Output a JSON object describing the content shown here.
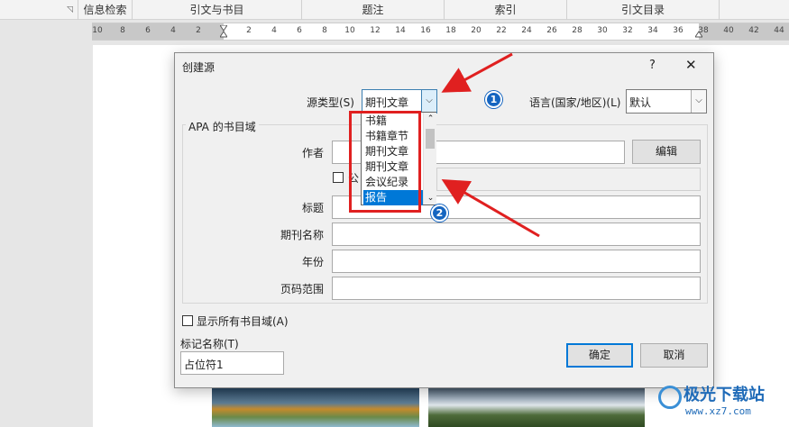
{
  "ribbon": {
    "groups": [
      "信息检索",
      "引文与书目",
      "题注",
      "索引",
      "引文目录"
    ]
  },
  "ruler": {
    "left_ticks": [
      "10",
      "8",
      "6",
      "4",
      "2"
    ],
    "right_ticks": [
      "2",
      "4",
      "6",
      "8",
      "10",
      "12",
      "14",
      "16",
      "18",
      "20",
      "22",
      "24",
      "26",
      "28",
      "30",
      "32",
      "34",
      "36",
      "38",
      "40",
      "42",
      "44"
    ]
  },
  "dialog": {
    "title": "创建源",
    "help": "?",
    "close": "✕",
    "source_type_label": "源类型(S)",
    "source_type_value": "期刊文章",
    "language_label": "语言(国家/地区)(L)",
    "language_value": "默认",
    "group_title": "APA 的书目域",
    "author_label": "作者",
    "edit_button": "编辑",
    "corporate_label": "公",
    "title_label": "标题",
    "journal_label": "期刊名称",
    "year_label": "年份",
    "pages_label": "页码范围",
    "show_all_label": "显示所有书目域(A)",
    "tag_name_label": "标记名称(T)",
    "tag_name_value": "占位符1",
    "ok_button": "确定",
    "cancel_button": "取消"
  },
  "dropdown": {
    "items": [
      "书籍",
      "书籍章节",
      "期刊文章",
      "期刊文章",
      "会议纪录",
      "报告"
    ],
    "selected_index": 5
  },
  "annotations": {
    "badge1": "1",
    "badge2": "2",
    "color": "#e02020"
  },
  "watermark": {
    "text": "极光下载站",
    "url": "www.xz7.com"
  }
}
